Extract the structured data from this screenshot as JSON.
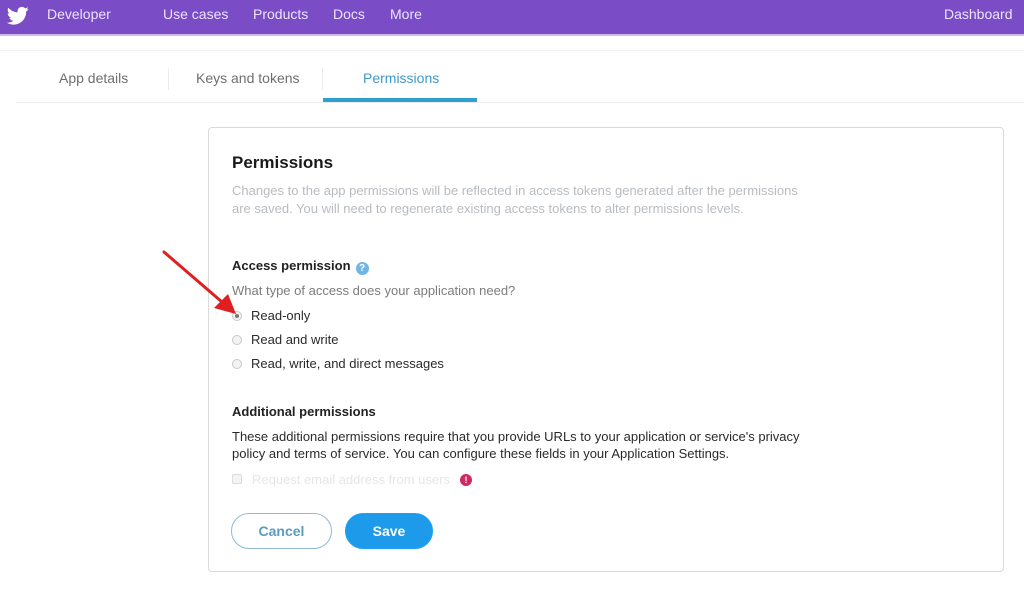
{
  "topbar": {
    "logo": "twitter-bird-icon",
    "brand": "Developer",
    "nav": [
      "Use cases",
      "Products",
      "Docs",
      "More"
    ],
    "right_link": "Dashboard",
    "color": "#7a4cc6"
  },
  "tabs": [
    {
      "label": "App details",
      "active": false
    },
    {
      "label": "Keys and tokens",
      "active": false
    },
    {
      "label": "Permissions",
      "active": true
    }
  ],
  "card": {
    "title": "Permissions",
    "description": "Changes to the app permissions will be reflected in access tokens generated after the permissions are saved. You will need to regenerate existing access tokens to alter permissions levels.",
    "access": {
      "title": "Access permission",
      "help_icon": "question-circle-icon",
      "question": "What type of access does your application need?",
      "options": [
        {
          "label": "Read-only",
          "selected": true
        },
        {
          "label": "Read and write",
          "selected": false
        },
        {
          "label": "Read, write, and direct messages",
          "selected": false
        }
      ]
    },
    "additional": {
      "title": "Additional permissions",
      "description": "These additional permissions require that you provide URLs to your application or service's privacy policy and terms of service. You can configure these fields in your Application Settings.",
      "checkbox_label": "Request email address from users",
      "checkbox_checked": false,
      "checkbox_disabled": true,
      "warning_icon": "!"
    },
    "buttons": {
      "cancel": "Cancel",
      "save": "Save"
    }
  },
  "annotation": {
    "arrow_color": "#e02020",
    "points_to": "Read-only"
  }
}
